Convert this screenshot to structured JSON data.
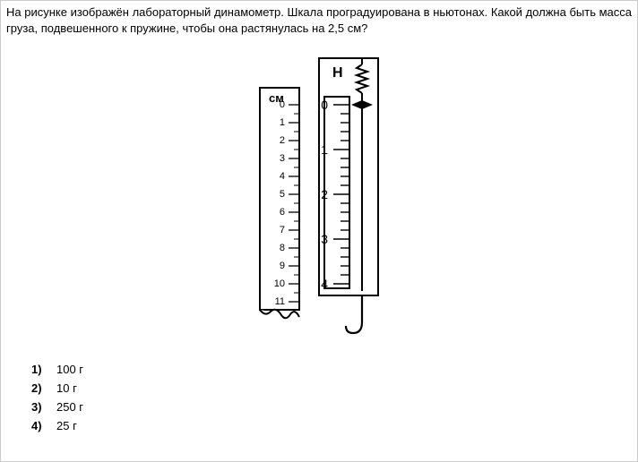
{
  "question": "На рисунке изображён лабораторный динамометр. Шкала проградуирована в ньютонах. Какой должна быть масса груза, подвешенного к пружине, чтобы она растянулась на 2,5 см?",
  "scale_labels": {
    "cm": "см",
    "N": "Н",
    "cm_ticks": [
      "0",
      "1",
      "2",
      "3",
      "4",
      "5",
      "6",
      "7",
      "8",
      "9",
      "10",
      "11"
    ],
    "N_ticks": [
      "0",
      "1",
      "2",
      "3",
      "4"
    ]
  },
  "options": [
    {
      "num": "1)",
      "text": "100 г"
    },
    {
      "num": "2)",
      "text": "10 г"
    },
    {
      "num": "3)",
      "text": "250 г"
    },
    {
      "num": "4)",
      "text": "25 г"
    }
  ],
  "chart_data": {
    "type": "diagram",
    "description": "Лабораторный динамометр с двумя шкалами",
    "left_scale": {
      "unit": "см",
      "min": 0,
      "max": 11,
      "major_step": 1
    },
    "right_scale": {
      "unit": "Н",
      "min": 0,
      "max": 4,
      "major_step": 1,
      "minor_divisions_per_major": 5,
      "cm_per_newton": 2.5
    },
    "pointer_at_N": 0
  }
}
